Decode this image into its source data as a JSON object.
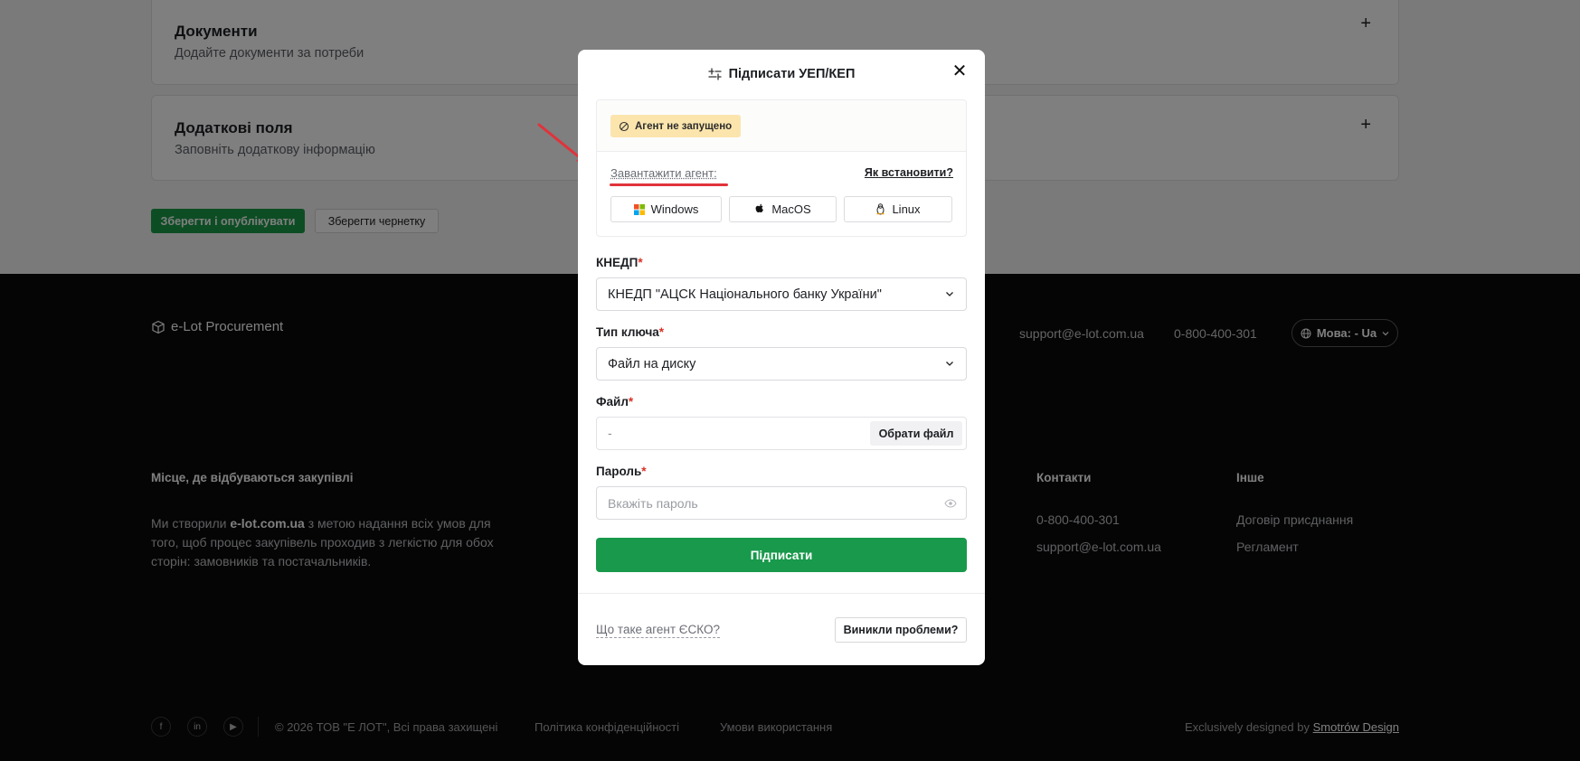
{
  "page": {
    "cards": [
      {
        "title": "Документи",
        "subtitle": "Додайте документи за потреби",
        "action": "+"
      },
      {
        "title": "Додаткові поля",
        "subtitle": "Заповніть додаткову інформацію",
        "action": "+"
      }
    ],
    "publish_label": "Зберегти і опублікувати",
    "draft_label": "Зберегти чернетку"
  },
  "footer": {
    "logo": "e-Lot Procurement",
    "email": "support@e-lot.com.ua",
    "phone": "0-800-400-301",
    "language": "Мова: - Ua",
    "about_heading": "Місце, де відбуваються закупівлі",
    "about_pre": "Ми створили ",
    "about_brand": "e-lot.com.ua",
    "about_post": " з метою надання всіх умов для того, щоб процес закупівель проходив з легкістю для обох сторін: замовників та постачальників.",
    "contacts_heading": "Контакти",
    "contacts": [
      "0-800-400-301",
      "support@e-lot.com.ua"
    ],
    "other_heading": "Інше",
    "other": [
      "Договір присднання",
      "Регламент"
    ],
    "social": [
      "f",
      "in",
      "▶"
    ],
    "copyright": "© 2026 ТОВ \"Е ЛОТ\", Всі права захищені",
    "privacy": "Політика конфіденційності",
    "terms": "Умови використання",
    "designed_by": "Exclusively designed by",
    "designer": "Smotrów Design"
  },
  "modal": {
    "title": "Підписати УЕП/КЕП",
    "close": "✕",
    "agent_status": "Агент не запущено",
    "download_agent": "Завантажити агент:",
    "how_install": "Як встановити?",
    "os_buttons": [
      "Windows",
      "MacOS",
      "Linux"
    ],
    "kndp_label": "КНЕДП",
    "kndp_value": "КНЕДП \"АЦСК Національного банку України\"",
    "key_type_label": "Тип ключа",
    "key_type_value": "Файл на диску",
    "file_label": "Файл",
    "file_value": "-",
    "pick_file": "Обрати файл",
    "password_label": "Пароль",
    "password_placeholder": "Вкажіть пароль",
    "required_mark": "*",
    "sign_button": "Підписати",
    "what_is_agent": "Що таке агент ЄСКО?",
    "problems": "Виникли проблеми?"
  },
  "colors": {
    "primary_green": "#18994b",
    "badge_yellow": "#fbe5ad",
    "annotation_red": "#e0333a",
    "footer_bg": "#0a0a0b"
  }
}
